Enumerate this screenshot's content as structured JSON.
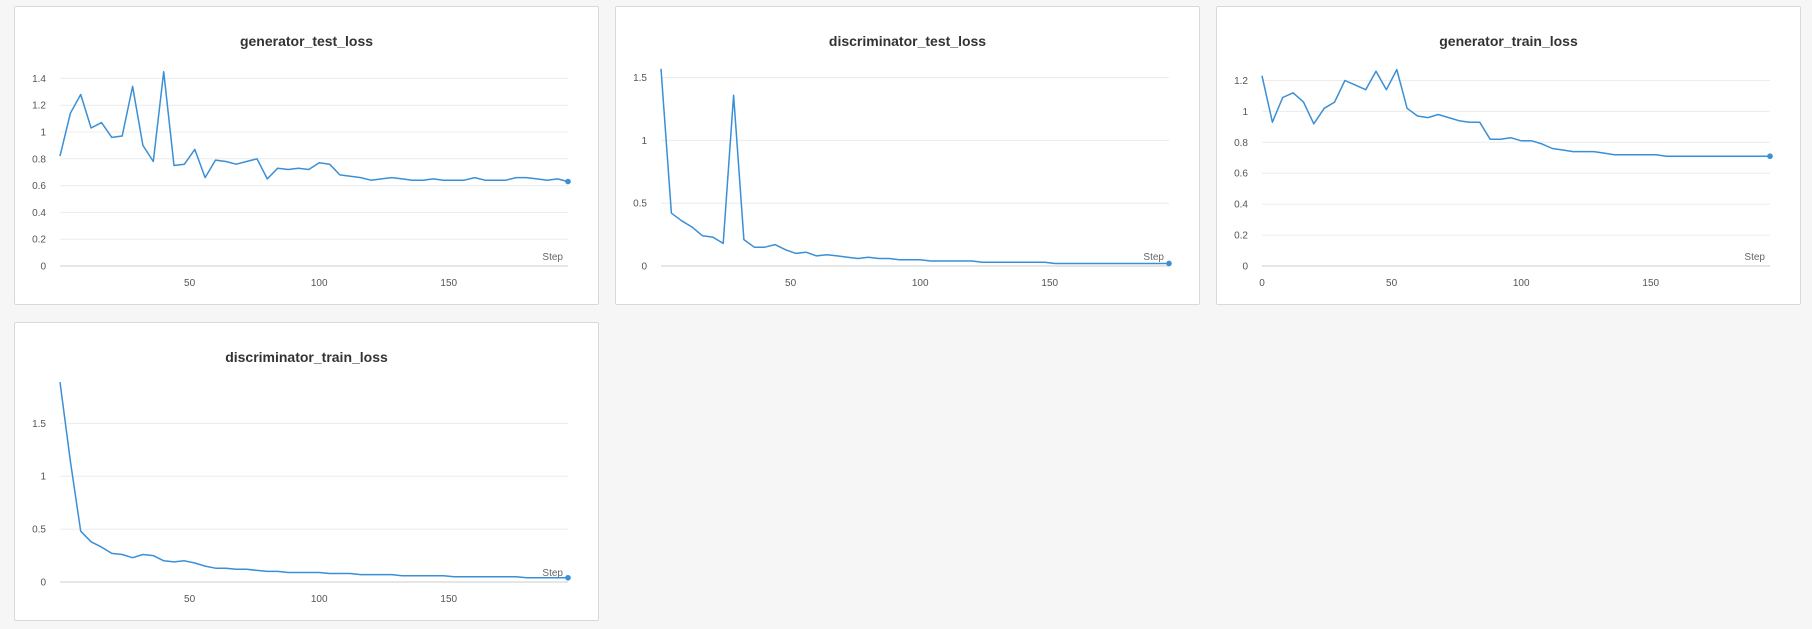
{
  "colors": {
    "series": "#3a8fd6",
    "grid": "#ececec",
    "axis": "#cccccc",
    "background": "#f6f6f6"
  },
  "chart_data": [
    {
      "type": "line",
      "title": "generator_test_loss",
      "xlabel": "Step",
      "ylabel": "",
      "xlim": [
        0,
        196
      ],
      "ylim": [
        0,
        1.5
      ],
      "xticks": [
        50,
        100,
        150
      ],
      "yticks": [
        0,
        0.2,
        0.4,
        0.6,
        0.8,
        1,
        1.2,
        1.4
      ],
      "ytick_labels": [
        "0",
        "0.2",
        "0.4",
        "0.6",
        "0.8",
        "1",
        "1.2",
        "1.4"
      ],
      "xtick_labels": [
        "50",
        "100",
        "150"
      ],
      "grid": true,
      "series": [
        {
          "x": [
            0,
            4,
            8,
            12,
            16,
            20,
            24,
            28,
            32,
            36,
            40,
            44,
            48,
            52,
            56,
            60,
            64,
            68,
            72,
            76,
            80,
            84,
            88,
            92,
            96,
            100,
            104,
            108,
            112,
            116,
            120,
            124,
            128,
            132,
            136,
            140,
            144,
            148,
            152,
            156,
            160,
            164,
            168,
            172,
            176,
            180,
            184,
            188,
            192,
            196
          ],
          "y": [
            0.82,
            1.14,
            1.28,
            1.03,
            1.07,
            0.96,
            0.97,
            1.34,
            0.9,
            0.78,
            1.45,
            0.75,
            0.76,
            0.87,
            0.66,
            0.79,
            0.78,
            0.76,
            0.78,
            0.8,
            0.65,
            0.73,
            0.72,
            0.73,
            0.72,
            0.77,
            0.76,
            0.68,
            0.67,
            0.66,
            0.64,
            0.65,
            0.66,
            0.65,
            0.64,
            0.64,
            0.65,
            0.64,
            0.64,
            0.64,
            0.66,
            0.64,
            0.64,
            0.64,
            0.66,
            0.66,
            0.65,
            0.64,
            0.65,
            0.63
          ]
        }
      ]
    },
    {
      "type": "line",
      "title": "discriminator_test_loss",
      "xlabel": "Step",
      "ylabel": "",
      "xlim": [
        0,
        196
      ],
      "ylim": [
        0,
        1.6
      ],
      "xticks": [
        50,
        100,
        150
      ],
      "yticks": [
        0,
        0.5,
        1,
        1.5
      ],
      "ytick_labels": [
        "0",
        "0.5",
        "1",
        "1.5"
      ],
      "xtick_labels": [
        "50",
        "100",
        "150"
      ],
      "grid": true,
      "series": [
        {
          "x": [
            0,
            4,
            8,
            12,
            16,
            20,
            24,
            28,
            32,
            36,
            40,
            44,
            48,
            52,
            56,
            60,
            64,
            68,
            72,
            76,
            80,
            84,
            88,
            92,
            96,
            100,
            104,
            108,
            112,
            116,
            120,
            124,
            128,
            132,
            136,
            140,
            144,
            148,
            152,
            156,
            160,
            164,
            168,
            172,
            176,
            180,
            184,
            188,
            192,
            196
          ],
          "y": [
            1.57,
            0.42,
            0.36,
            0.31,
            0.24,
            0.23,
            0.18,
            1.36,
            0.21,
            0.15,
            0.15,
            0.17,
            0.13,
            0.1,
            0.11,
            0.08,
            0.09,
            0.08,
            0.07,
            0.06,
            0.07,
            0.06,
            0.06,
            0.05,
            0.05,
            0.05,
            0.04,
            0.04,
            0.04,
            0.04,
            0.04,
            0.03,
            0.03,
            0.03,
            0.03,
            0.03,
            0.03,
            0.03,
            0.02,
            0.02,
            0.02,
            0.02,
            0.02,
            0.02,
            0.02,
            0.02,
            0.02,
            0.02,
            0.02,
            0.02
          ]
        }
      ]
    },
    {
      "type": "line",
      "title": "generator_train_loss",
      "xlabel": "Step",
      "ylabel": "",
      "xlim": [
        0,
        196
      ],
      "ylim": [
        0,
        1.3
      ],
      "xticks": [
        0,
        50,
        100,
        150
      ],
      "yticks": [
        0,
        0.2,
        0.4,
        0.6,
        0.8,
        1,
        1.2
      ],
      "ytick_labels": [
        "0",
        "0.2",
        "0.4",
        "0.6",
        "0.8",
        "1",
        "1.2"
      ],
      "xtick_labels": [
        "0",
        "50",
        "100",
        "150"
      ],
      "grid": true,
      "series": [
        {
          "x": [
            0,
            4,
            8,
            12,
            16,
            20,
            24,
            28,
            32,
            36,
            40,
            44,
            48,
            52,
            56,
            60,
            64,
            68,
            72,
            76,
            80,
            84,
            88,
            92,
            96,
            100,
            104,
            108,
            112,
            116,
            120,
            124,
            128,
            132,
            136,
            140,
            144,
            148,
            152,
            156,
            160,
            164,
            168,
            172,
            176,
            180,
            184,
            188,
            192,
            196
          ],
          "y": [
            1.23,
            0.93,
            1.09,
            1.12,
            1.06,
            0.92,
            1.02,
            1.06,
            1.2,
            1.17,
            1.14,
            1.26,
            1.14,
            1.27,
            1.02,
            0.97,
            0.96,
            0.98,
            0.96,
            0.94,
            0.93,
            0.93,
            0.82,
            0.82,
            0.83,
            0.81,
            0.81,
            0.79,
            0.76,
            0.75,
            0.74,
            0.74,
            0.74,
            0.73,
            0.72,
            0.72,
            0.72,
            0.72,
            0.72,
            0.71,
            0.71,
            0.71,
            0.71,
            0.71,
            0.71,
            0.71,
            0.71,
            0.71,
            0.71,
            0.71
          ]
        }
      ]
    },
    {
      "type": "line",
      "title": "discriminator_train_loss",
      "xlabel": "Step",
      "ylabel": "",
      "xlim": [
        0,
        196
      ],
      "ylim": [
        0,
        1.9
      ],
      "xticks": [
        50,
        100,
        150
      ],
      "yticks": [
        0,
        0.5,
        1,
        1.5
      ],
      "ytick_labels": [
        "0",
        "0.5",
        "1",
        "1.5"
      ],
      "xtick_labels": [
        "50",
        "100",
        "150"
      ],
      "grid": true,
      "series": [
        {
          "x": [
            0,
            4,
            8,
            12,
            16,
            20,
            24,
            28,
            32,
            36,
            40,
            44,
            48,
            52,
            56,
            60,
            64,
            68,
            72,
            76,
            80,
            84,
            88,
            92,
            96,
            100,
            104,
            108,
            112,
            116,
            120,
            124,
            128,
            132,
            136,
            140,
            144,
            148,
            152,
            156,
            160,
            164,
            168,
            172,
            176,
            180,
            184,
            188,
            192,
            196
          ],
          "y": [
            1.89,
            1.14,
            0.48,
            0.38,
            0.33,
            0.27,
            0.26,
            0.23,
            0.26,
            0.25,
            0.2,
            0.19,
            0.2,
            0.18,
            0.15,
            0.13,
            0.13,
            0.12,
            0.12,
            0.11,
            0.1,
            0.1,
            0.09,
            0.09,
            0.09,
            0.09,
            0.08,
            0.08,
            0.08,
            0.07,
            0.07,
            0.07,
            0.07,
            0.06,
            0.06,
            0.06,
            0.06,
            0.06,
            0.05,
            0.05,
            0.05,
            0.05,
            0.05,
            0.05,
            0.05,
            0.04,
            0.04,
            0.04,
            0.04,
            0.04
          ]
        }
      ]
    }
  ]
}
